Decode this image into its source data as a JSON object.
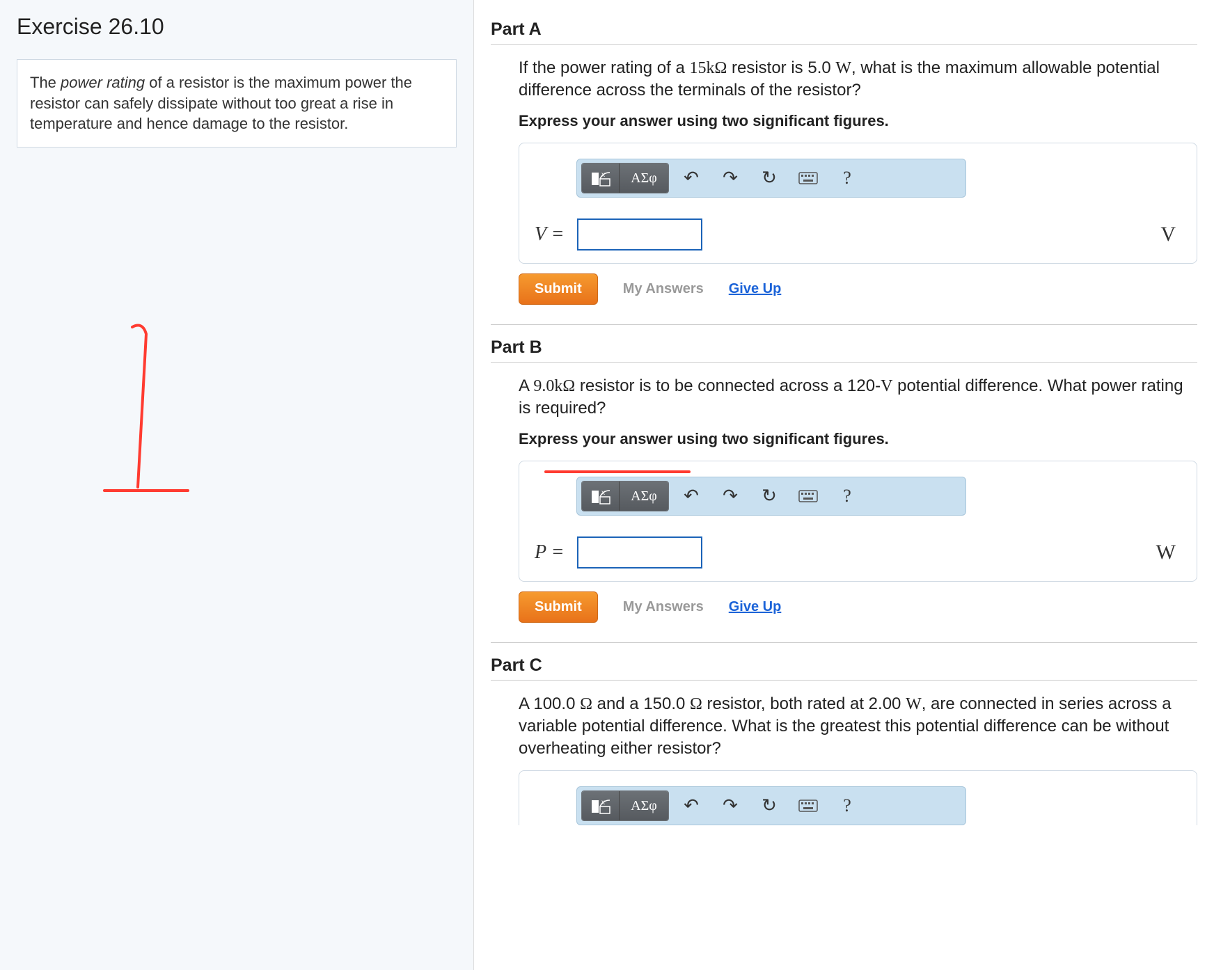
{
  "exercise_title": "Exercise 26.10",
  "intro_html": "The <em>power rating</em> of a resistor is the maximum power the resistor can safely dissipate without too great a rise in temperature and hence damage to the resistor.",
  "toolbar": {
    "templates_label": "▮",
    "math_label": "√□",
    "greek_label": "ΑΣφ",
    "undo_label": "↶",
    "redo_label": "↷",
    "reset_label": "↻",
    "keyboard_label": "⌨",
    "help_label": "?"
  },
  "buttons": {
    "submit": "Submit",
    "my_answers": "My Answers",
    "give_up": "Give Up"
  },
  "parts": {
    "A": {
      "title": "Part A",
      "question_html": "If the power rating of a <span class='chart-style-math'>15kΩ</span> resistor is 5.0 <span class='chart-style-math'>W</span>, what is the maximum allowable potential difference across the terminals of the resistor?",
      "instruction": "Express your answer using two significant figures.",
      "var_label": "V =",
      "unit": "V",
      "value": ""
    },
    "B": {
      "title": "Part B",
      "question_html": "A <span class='chart-style-math'>9.0kΩ</span> resistor is to be connected across a 120-<span class='chart-style-math'>V</span> potential difference. What power rating is required?",
      "instruction": "Express your answer using two significant figures.",
      "var_label": "P =",
      "unit": "W",
      "value": ""
    },
    "C": {
      "title": "Part C",
      "question_html": "A 100.0 <span class='chart-style-math'>Ω</span> and a 150.0 <span class='chart-style-math'>Ω</span> resistor, both rated at 2.00 <span class='chart-style-math'>W</span>, are connected in series across a variable potential difference. What is the greatest this potential difference can be without overheating either resistor?"
    }
  }
}
